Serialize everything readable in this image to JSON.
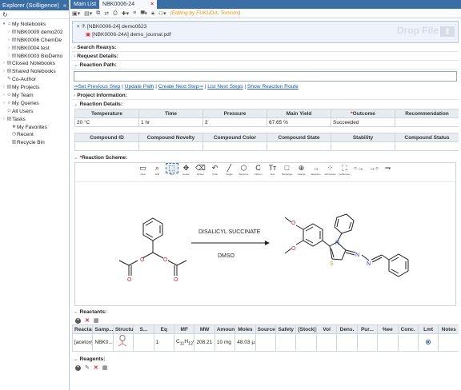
{
  "explorer": {
    "title": "Explorer (Scilligence)",
    "collapse_glyph": "«",
    "refresh_glyph": "↻",
    "items": [
      {
        "label": "My Notebooks",
        "level": 0,
        "arrow": "▾",
        "icon": "⌂"
      },
      {
        "label": "NBK0009 demo202",
        "level": 1,
        "arrow": "›",
        "icon": "▤"
      },
      {
        "label": "NBK0006 ChemDe",
        "level": 1,
        "arrow": "›",
        "icon": "▤"
      },
      {
        "label": "NBK0004 test",
        "level": 1,
        "arrow": "›",
        "icon": "▤"
      },
      {
        "label": "NBK0003 BioDemo",
        "level": 1,
        "arrow": "›",
        "icon": "▤"
      },
      {
        "label": "Closed Notebooks",
        "level": 0,
        "arrow": "›",
        "icon": "▤"
      },
      {
        "label": "Shared Notebooks",
        "level": 0,
        "arrow": "›",
        "icon": "▤"
      },
      {
        "label": "Co-Author",
        "level": 0,
        "arrow": "",
        "icon": "✎"
      },
      {
        "label": "My Projects",
        "level": 0,
        "arrow": "›",
        "icon": "▤"
      },
      {
        "label": "My Team",
        "level": 0,
        "arrow": "›",
        "icon": "☺"
      },
      {
        "label": "My Queries",
        "level": 0,
        "arrow": "›",
        "icon": "⌕"
      },
      {
        "label": "All Users",
        "level": 0,
        "arrow": "",
        "icon": "☺"
      },
      {
        "label": "Tasks",
        "level": 0,
        "arrow": "›",
        "icon": "▤"
      },
      {
        "label": "My Favorites",
        "level": 1,
        "arrow": "",
        "icon": "★"
      },
      {
        "label": "Recent",
        "level": 1,
        "arrow": "",
        "icon": "◷"
      },
      {
        "label": "Recycle Bin",
        "level": 1,
        "arrow": "",
        "icon": "▥"
      }
    ]
  },
  "tabs": {
    "main": "Main List",
    "current": "NBK0006-24",
    "close": "×"
  },
  "toolbar": {
    "editing": "(Editing by FUKUDA, Tomomi)"
  },
  "attachments": {
    "parent": "[NBK0006-24] demo0623",
    "child": "[NBK0006-24A] demo_journal.pdf",
    "drop_label": "Drop File",
    "drop_glyph": "⇧"
  },
  "sections": {
    "search_reaxys": "Search Reaxys:",
    "request_details": "Request Details:",
    "reaction_path": "Reaction Path:",
    "project_info": "Project Information:",
    "reaction_details": "Reaction Details:",
    "reaction_scheme": "Reaction Scheme:",
    "reactants": "Reactants:",
    "reagents": "Reagents:"
  },
  "path_links": [
    "⇒Set Previous Step",
    "Update Path",
    "Create Next Step⇒",
    "List Next Steps",
    "Show Reaction Route"
  ],
  "details_table": {
    "headers": [
      "Temperature",
      "Time",
      "Pressure",
      "Main Yield",
      "*Outcome",
      "Recommendation"
    ],
    "row": [
      "20 °C",
      "1 hr",
      "2",
      "67.65 %",
      "Succeeded",
      ""
    ]
  },
  "compound_table": {
    "headers": [
      "Compound ID",
      "Compound Novelty",
      "Compound Color",
      "Compound State",
      "Stability",
      "Compound Status"
    ]
  },
  "ketcher_tools": [
    {
      "g": "▭",
      "l": "New"
    },
    {
      "g": "⌕",
      "l": "Hilit"
    },
    {
      "g": "⬚",
      "l": "Box"
    },
    {
      "g": "✥",
      "l": "Center"
    },
    {
      "g": "⌫",
      "l": "Eraser"
    },
    {
      "g": "↶",
      "l": "Undo"
    },
    {
      "g": "╱",
      "l": "Single"
    },
    {
      "g": "⬡",
      "l": "Benzene"
    },
    {
      "g": "C",
      "l": "Carbon"
    },
    {
      "g": "Tт",
      "l": "Text"
    },
    {
      "g": "□",
      "l": "Rectangle"
    },
    {
      "g": "⊕",
      "l": "Charge"
    },
    {
      "g": "→",
      "l": "Reaction"
    },
    {
      "g": "⁘",
      "l": "Wordmars"
    },
    {
      "g": "⛶",
      "l": "FullScreen"
    },
    {
      "g": "▫→",
      "l": ""
    },
    {
      "g": "→▫",
      "l": ""
    },
    {
      "g": "⇁",
      "l": ""
    }
  ],
  "reaction": {
    "reagent_above": "DISALICYL SUCCINATE",
    "reagent_below": "DMSO"
  },
  "atoms": {
    "o": "O",
    "s": "S",
    "n": "N"
  },
  "reactants_table": {
    "headers": [
      "Reactant",
      "Samp...",
      "Structure",
      "S...",
      "Eq",
      "MF",
      "MW",
      "Amount",
      "Moles",
      "Source",
      "Safety",
      "[Stock]",
      "Vol",
      "Dens.",
      "Pur...",
      "%ee",
      "Conc.",
      "Lmt",
      "Notes"
    ],
    "row": [
      "[acetoxy(p...",
      "NBK0...",
      "",
      "",
      "1",
      "C11H12O4",
      "208.21",
      "10 mg",
      "48.03 µ...",
      "",
      "",
      "",
      "",
      "",
      "",
      "",
      "",
      "",
      ""
    ]
  },
  "colors": {
    "header_blue": "#3a6ea5",
    "link_blue": "#1a5aa8",
    "required_red": "#d22",
    "editing_orange": "#e59a14",
    "thiazole_s": "#c9a400",
    "azine_n": "#1c3fd0"
  }
}
